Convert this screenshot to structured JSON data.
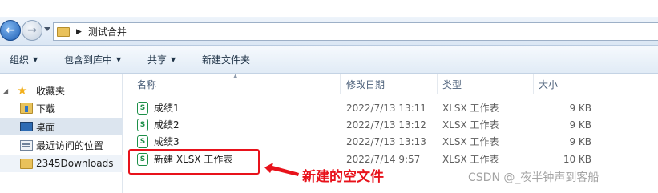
{
  "address_bar": {
    "breadcrumb": "测试合并"
  },
  "toolbar": {
    "items": [
      "组织",
      "包含到库中",
      "共享",
      "新建文件夹"
    ]
  },
  "sidebar": {
    "favorites_label": "收藏夹",
    "items": [
      "下载",
      "桌面",
      "最近访问的位置",
      "2345Downloads"
    ]
  },
  "columns": {
    "name": "名称",
    "date": "修改日期",
    "type": "类型",
    "size": "大小"
  },
  "files": [
    {
      "name": "成绩1",
      "date": "2022/7/13 13:11",
      "type": "XLSX 工作表",
      "size": "9 KB"
    },
    {
      "name": "成绩2",
      "date": "2022/7/13 13:12",
      "type": "XLSX 工作表",
      "size": "9 KB"
    },
    {
      "name": "成绩3",
      "date": "2022/7/13 13:13",
      "type": "XLSX 工作表",
      "size": "9 KB"
    },
    {
      "name": "新建 XLSX 工作表",
      "date": "2022/7/14 9:57",
      "type": "XLSX 工作表",
      "size": "10 KB"
    }
  ],
  "file_icon_glyph": "S",
  "annotation": "新建的空文件",
  "watermark": "CSDN @_夜半钟声到客船",
  "colors": {
    "annotation_red": "#e8121b",
    "excel_green": "#1d8f48",
    "selected_nav": "#dce5ef"
  }
}
